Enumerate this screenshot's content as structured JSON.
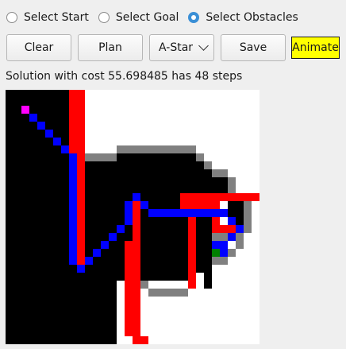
{
  "mode_options": [
    {
      "label": "Select Start",
      "checked": false
    },
    {
      "label": "Select Goal",
      "checked": false
    },
    {
      "label": "Select Obstacles",
      "checked": true
    }
  ],
  "toolbar": {
    "clear_label": "Clear",
    "plan_label": "Plan",
    "algorithm_value": "A-Star",
    "save_label": "Save",
    "animate_label": "Animate"
  },
  "status_text": "Solution with cost 55.698485 has 48 steps",
  "grid": {
    "cols": 32,
    "rows": 32,
    "colors": {
      "free": "#ffffff",
      "obstacle": "#000000",
      "inflated": "#808080",
      "swept": "#ff0000",
      "path": "#0000ff",
      "start": "#ff00ff",
      "goal": "#008000"
    },
    "cells": [
      "0000000000000000",
      "obstacle_start",
      "0000000000000000"
    ],
    "path": [
      [
        2,
        2
      ],
      [
        3,
        3
      ],
      [
        4,
        4
      ],
      [
        5,
        5
      ],
      [
        6,
        6
      ],
      [
        7,
        7
      ],
      [
        8,
        8
      ],
      [
        8,
        9
      ],
      [
        8,
        10
      ],
      [
        8,
        11
      ],
      [
        8,
        12
      ],
      [
        8,
        13
      ],
      [
        8,
        14
      ],
      [
        8,
        15
      ],
      [
        8,
        16
      ],
      [
        8,
        17
      ],
      [
        8,
        18
      ],
      [
        8,
        19
      ],
      [
        8,
        20
      ],
      [
        8,
        21
      ],
      [
        9,
        22
      ],
      [
        10,
        21
      ],
      [
        11,
        20
      ],
      [
        12,
        19
      ],
      [
        13,
        18
      ],
      [
        14,
        17
      ],
      [
        15,
        16
      ],
      [
        15,
        15
      ],
      [
        15,
        14
      ],
      [
        16,
        13
      ],
      [
        17,
        14
      ],
      [
        18,
        15
      ],
      [
        19,
        15
      ],
      [
        20,
        15
      ],
      [
        21,
        15
      ],
      [
        22,
        15
      ],
      [
        23,
        15
      ],
      [
        24,
        15
      ],
      [
        25,
        15
      ],
      [
        26,
        15
      ],
      [
        27,
        15
      ],
      [
        28,
        16
      ],
      [
        29,
        17
      ],
      [
        28,
        18
      ],
      [
        27,
        19
      ],
      [
        26,
        19
      ],
      [
        27,
        20
      ],
      [
        26,
        20
      ]
    ],
    "start": [
      2,
      2
    ],
    "goal": [
      26,
      20
    ]
  }
}
